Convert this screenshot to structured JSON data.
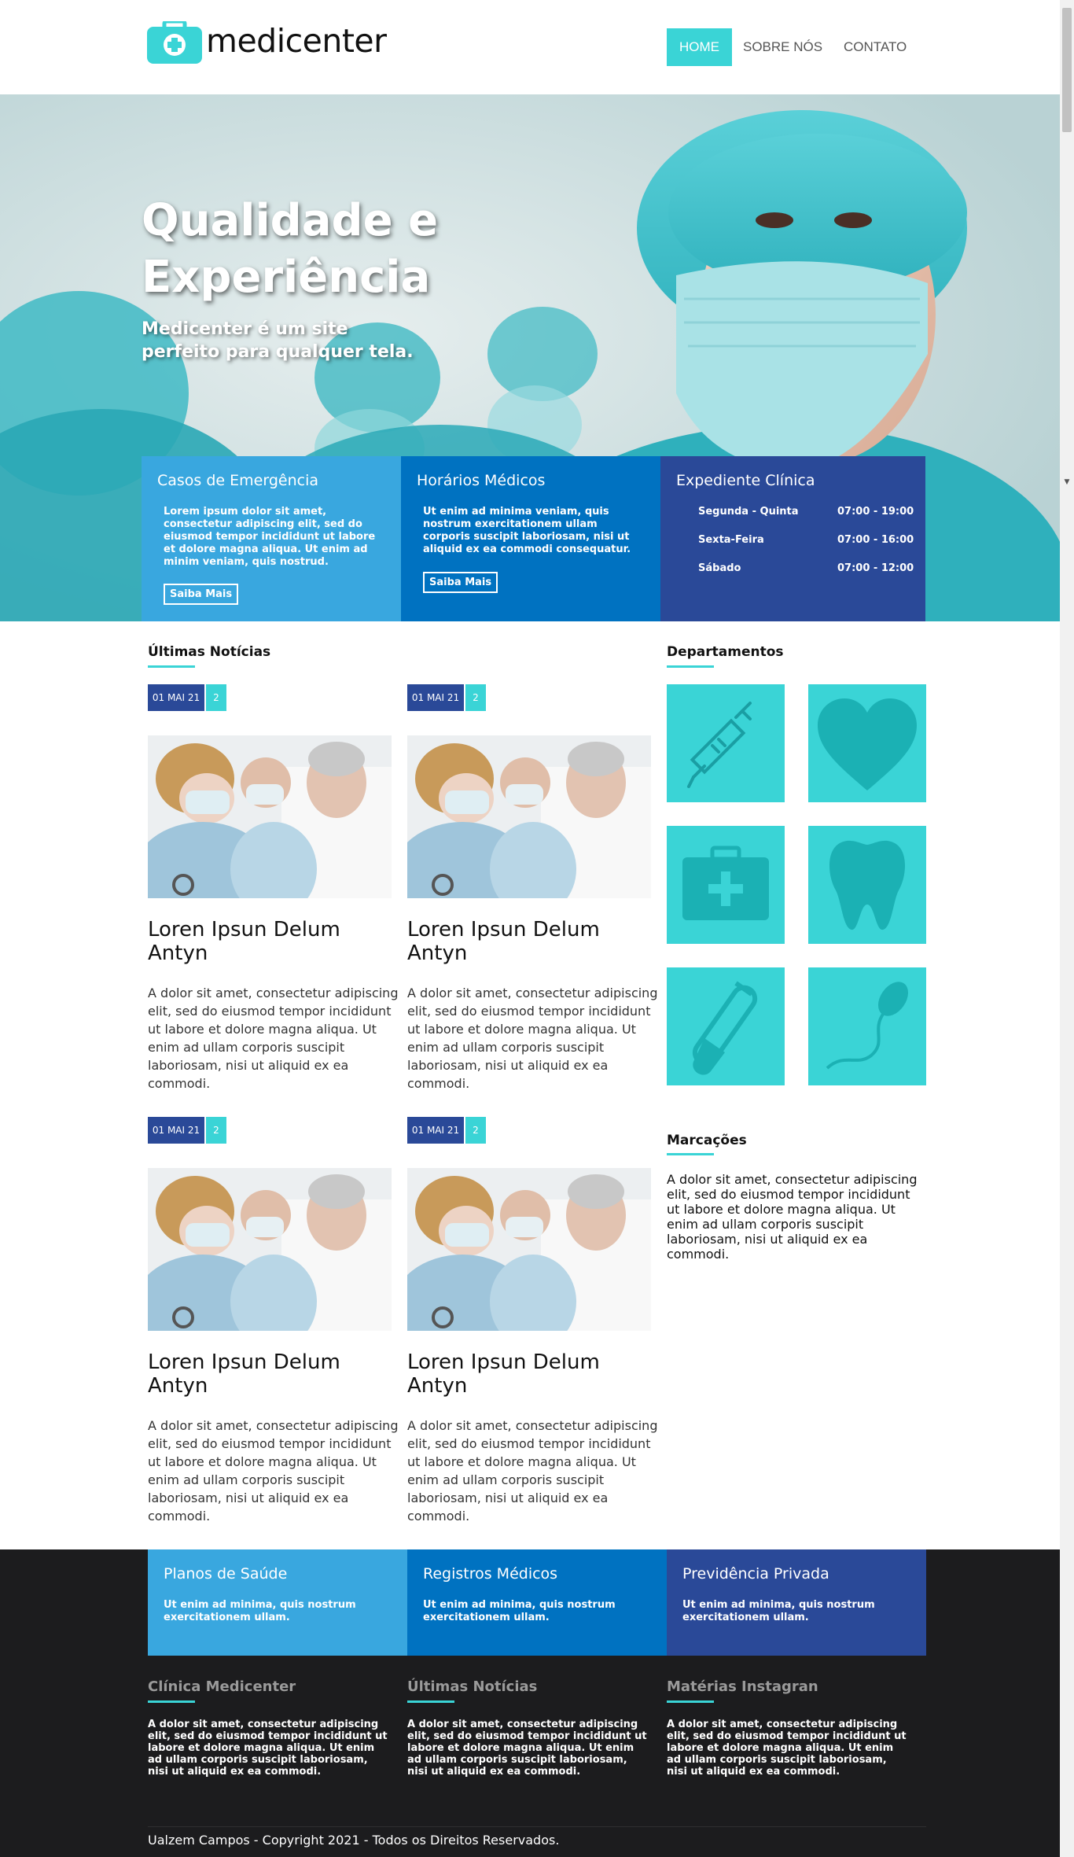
{
  "brand": {
    "name": "medicenter",
    "accent": "#3ad4d6"
  },
  "nav": {
    "items": [
      {
        "label": "HOME",
        "active": true
      },
      {
        "label": "SOBRE NÓS",
        "active": false
      },
      {
        "label": "CONTATO",
        "active": false
      }
    ]
  },
  "hero": {
    "title": "Qualidade e Experiência",
    "subtitle": "Medicenter é um site perfeito para qualquer tela."
  },
  "info_boxes": {
    "emergencia": {
      "title": "Casos de Emergência",
      "text": "Lorem ipsum dolor sit amet, consectetur adipiscing elit, sed do eiusmod tempor incididunt ut labore et dolore magna aliqua. Ut enim ad minim veniam, quis nostrud.",
      "button": "Saiba Mais",
      "color": "#39a7df"
    },
    "horarios": {
      "title": "Horários Médicos",
      "text": "Ut enim ad minima veniam, quis nostrum exercitationem ullam corporis suscipit laboriosam, nisi ut aliquid ex ea commodi consequatur.",
      "button": "Saiba Mais",
      "color": "#0072c1"
    },
    "expediente": {
      "title": "Expediente Clínica",
      "color": "#2a4998",
      "schedule": [
        {
          "day": "Segunda - Quinta",
          "time": "07:00 - 19:00"
        },
        {
          "day": "Sexta-Feira",
          "time": "07:00 - 16:00"
        },
        {
          "day": "Sábado",
          "time": "07:00 - 12:00"
        }
      ]
    }
  },
  "news": {
    "heading": "Últimas Notícias",
    "posts": [
      {
        "date": "01 MAI 21",
        "comments": "2",
        "title": "Loren Ipsun Delum Antyn",
        "text": "A dolor sit amet, consectetur adipiscing elit, sed do eiusmod tempor incididunt ut labore et dolore magna aliqua. Ut enim ad ullam corporis suscipit laboriosam, nisi ut aliquid ex ea commodi."
      },
      {
        "date": "01 MAI 21",
        "comments": "2",
        "title": "Loren Ipsun Delum Antyn",
        "text": "A dolor sit amet, consectetur adipiscing elit, sed do eiusmod tempor incididunt ut labore et dolore magna aliqua. Ut enim ad ullam corporis suscipit laboriosam, nisi ut aliquid ex ea commodi."
      },
      {
        "date": "01 MAI 21",
        "comments": "2",
        "title": "Loren Ipsun Delum Antyn",
        "text": "A dolor sit amet, consectetur adipiscing elit, sed do eiusmod tempor incididunt ut labore et dolore magna aliqua. Ut enim ad ullam corporis suscipit laboriosam, nisi ut aliquid ex ea commodi."
      },
      {
        "date": "01 MAI 21",
        "comments": "2",
        "title": "Loren Ipsun Delum Antyn",
        "text": "A dolor sit amet, consectetur adipiscing elit, sed do eiusmod tempor incididunt ut labore et dolore magna aliqua. Ut enim ad ullam corporis suscipit laboriosam, nisi ut aliquid ex ea commodi."
      }
    ]
  },
  "departments": {
    "heading": "Departamentos",
    "icons": [
      "syringe-icon",
      "heart-icon",
      "first-aid-kit-icon",
      "tooth-icon",
      "test-tube-icon",
      "sperm-icon"
    ]
  },
  "marcacoes": {
    "heading": "Marcações",
    "text": "A dolor sit amet, consectetur adipiscing elit, sed do eiusmod tempor incididunt ut labore et dolore magna aliqua. Ut enim ad ullam corporis suscipit laboriosam, nisi ut aliquid ex ea commodi."
  },
  "plans": [
    {
      "title": "Planos de Saúde",
      "text": "Ut enim ad minima, quis nostrum exercitationem ullam."
    },
    {
      "title": "Registros Médicos",
      "text": "Ut enim ad minima, quis nostrum exercitationem ullam."
    },
    {
      "title": "Previdência Privada",
      "text": "Ut enim ad minima, quis nostrum exercitationem ullam."
    }
  ],
  "footer": {
    "columns": [
      {
        "heading": "Clínica Medicenter",
        "text": "A dolor sit amet, consectetur adipiscing elit, sed do eiusmod tempor incididunt ut labore et dolore magna aliqua. Ut enim ad ullam corporis suscipit laboriosam, nisi ut aliquid ex ea commodi."
      },
      {
        "heading": "Últimas Notícias",
        "text": "A dolor sit amet, consectetur adipiscing elit, sed do eiusmod tempor incididunt ut labore et dolore magna aliqua. Ut enim ad ullam corporis suscipit laboriosam, nisi ut aliquid ex ea commodi."
      },
      {
        "heading": "Matérias Instagran",
        "text": "A dolor sit amet, consectetur adipiscing elit, sed do eiusmod tempor incididunt ut labore et dolore magna aliqua. Ut enim ad ullam corporis suscipit laboriosam, nisi ut aliquid ex ea commodi."
      }
    ],
    "copyright": "Ualzem Campos - Copyright 2021 - Todos os Direitos Reservados."
  }
}
